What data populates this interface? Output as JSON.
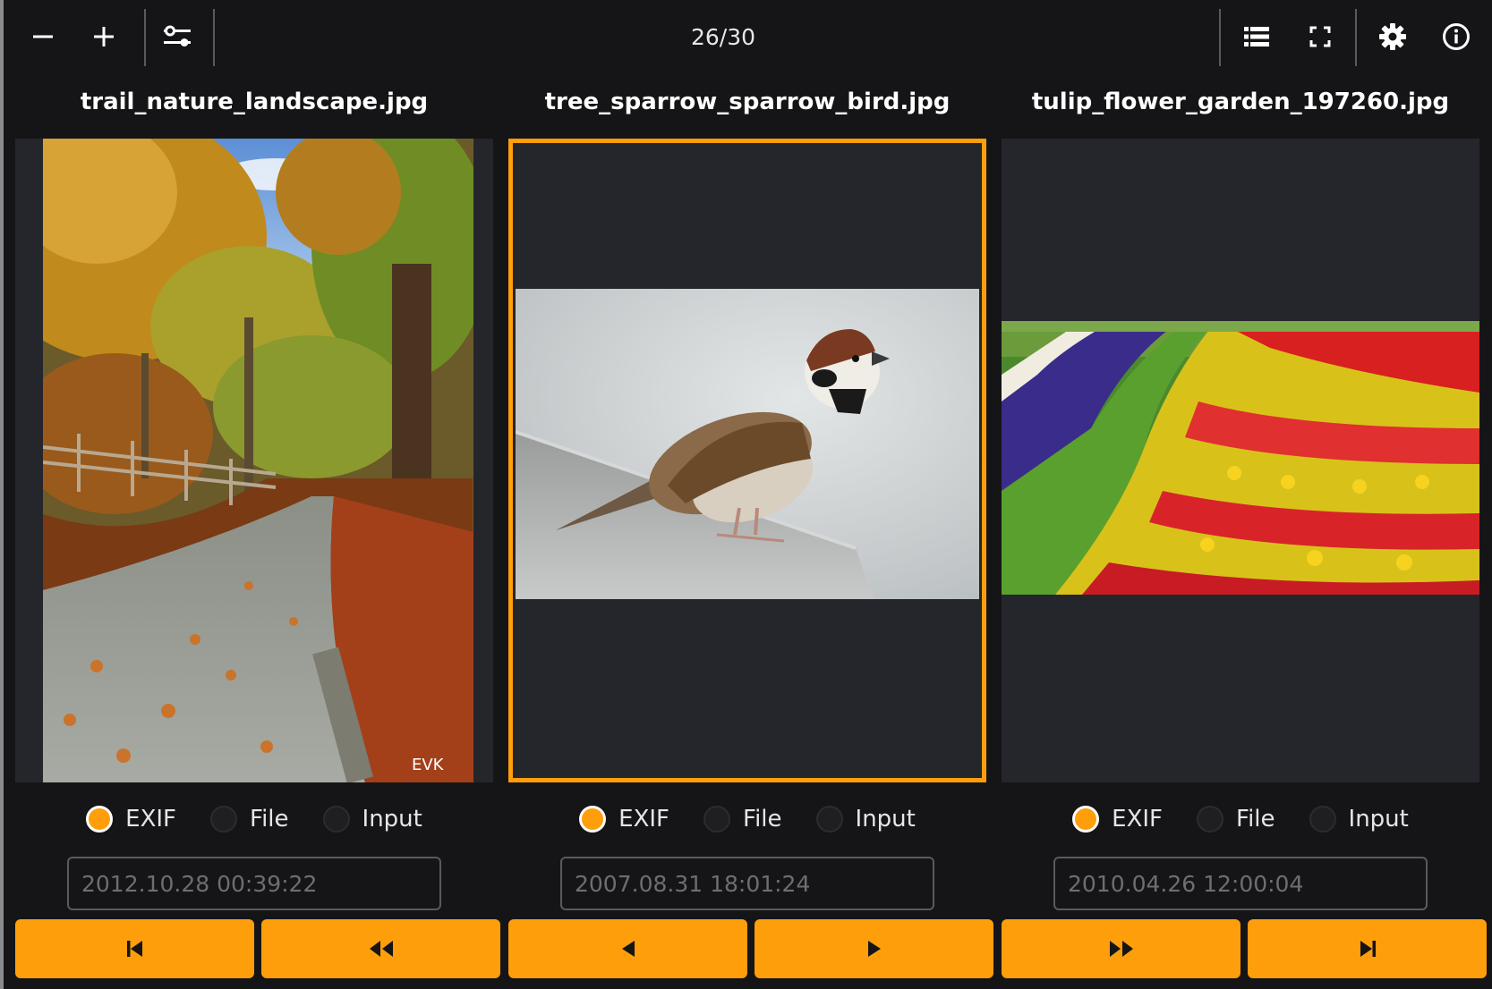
{
  "toolbar": {
    "counter": "26/30",
    "icons": [
      "zoom-out-icon",
      "zoom-in-icon",
      "adjust-sliders-icon",
      "list-view-icon",
      "fullscreen-icon",
      "settings-gear-icon",
      "info-icon"
    ]
  },
  "images": [
    {
      "filename": "trail_nature_landscape.jpg",
      "date_source": {
        "options": [
          "EXIF",
          "File",
          "Input"
        ],
        "selected": "EXIF"
      },
      "date_value": "2012.10.28 00:39:22",
      "watermark": "EVK"
    },
    {
      "filename": "tree_sparrow_sparrow_bird.jpg",
      "date_source": {
        "options": [
          "EXIF",
          "File",
          "Input"
        ],
        "selected": "EXIF"
      },
      "date_value": "2007.08.31 18:01:24"
    },
    {
      "filename": "tulip_flower_garden_197260.jpg",
      "date_source": {
        "options": [
          "EXIF",
          "File",
          "Input"
        ],
        "selected": "EXIF"
      },
      "date_value": "2010.04.26 12:00:04"
    }
  ],
  "navigation": {
    "buttons": [
      "first-icon",
      "fast-back-icon",
      "previous-icon",
      "next-icon",
      "fast-forward-icon",
      "last-icon"
    ]
  },
  "colors": {
    "accent": "#ff9e0b",
    "background": "#151517",
    "panel": "#25262b",
    "text": "#e6e6e6"
  }
}
